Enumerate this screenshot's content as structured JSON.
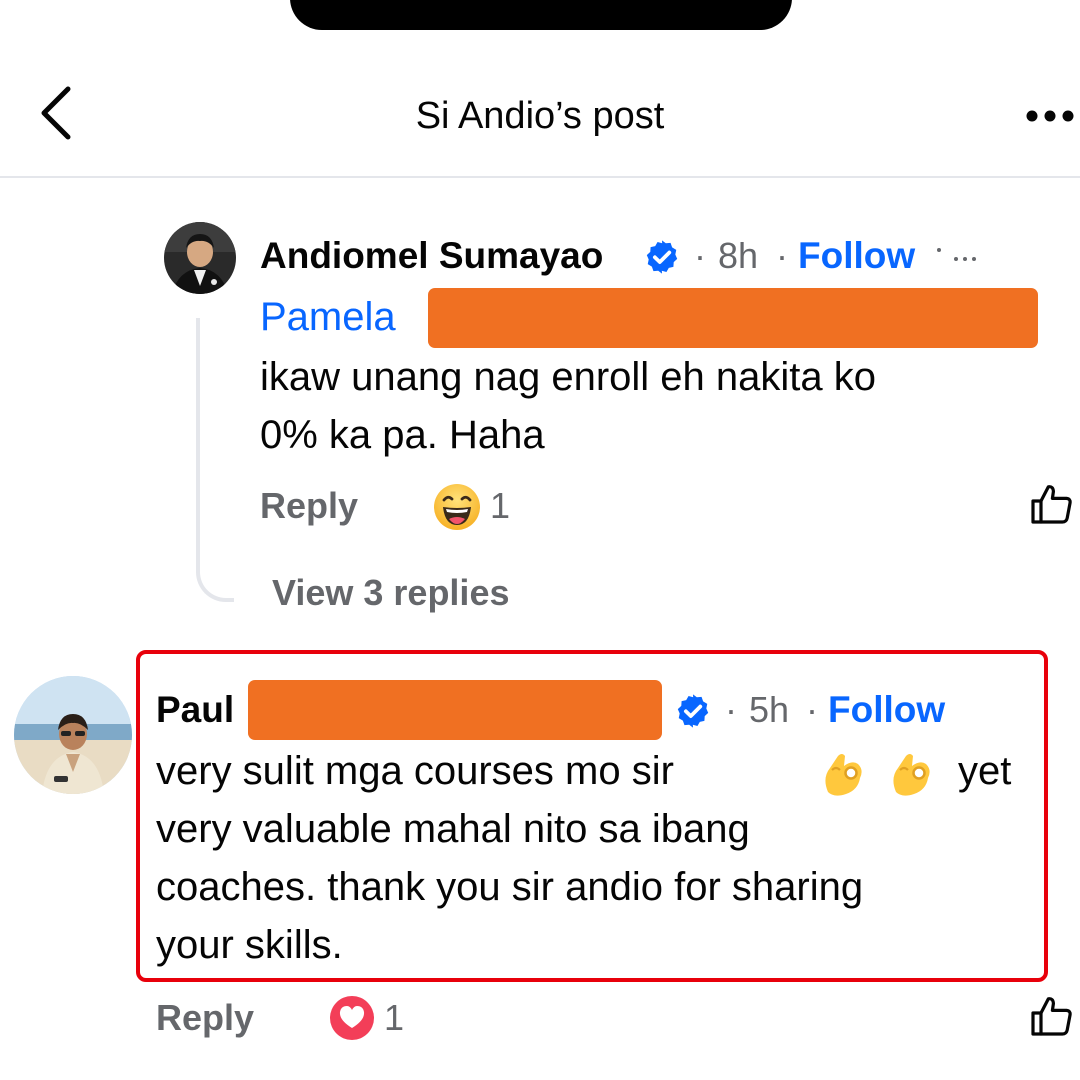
{
  "header": {
    "title": "Si Andio’s post"
  },
  "comments": [
    {
      "author": "Andiomel Sumayao",
      "verified": true,
      "time": "8h",
      "follow_label": "Follow",
      "mention": "Pamela",
      "body_line1": "ikaw unang nag enroll eh nakita ko",
      "body_line2": "0% ka pa. Haha",
      "reply_label": "Reply",
      "reaction_icon": "haha-face-icon",
      "reaction_count": "1",
      "view_replies": "View 3 replies"
    },
    {
      "author": "Paul",
      "verified": true,
      "time": "5h",
      "follow_label": "Follow",
      "body_line1_a": "very sulit mga courses mo sir",
      "body_line1_b": "yet",
      "body_line2": "very valuable mahal nito sa ibang",
      "body_line3": "coaches. thank you sir andio for sharing",
      "body_line4": "your skills.",
      "inline_emoji": "ok-hand-emoji",
      "reply_label": "Reply",
      "reaction_icon": "love-heart-icon",
      "reaction_count": "1"
    }
  ],
  "colors": {
    "accent_blue": "#0866ff",
    "redaction": "#f07022",
    "highlight_border": "#e8000b",
    "secondary_text": "#65676b"
  }
}
